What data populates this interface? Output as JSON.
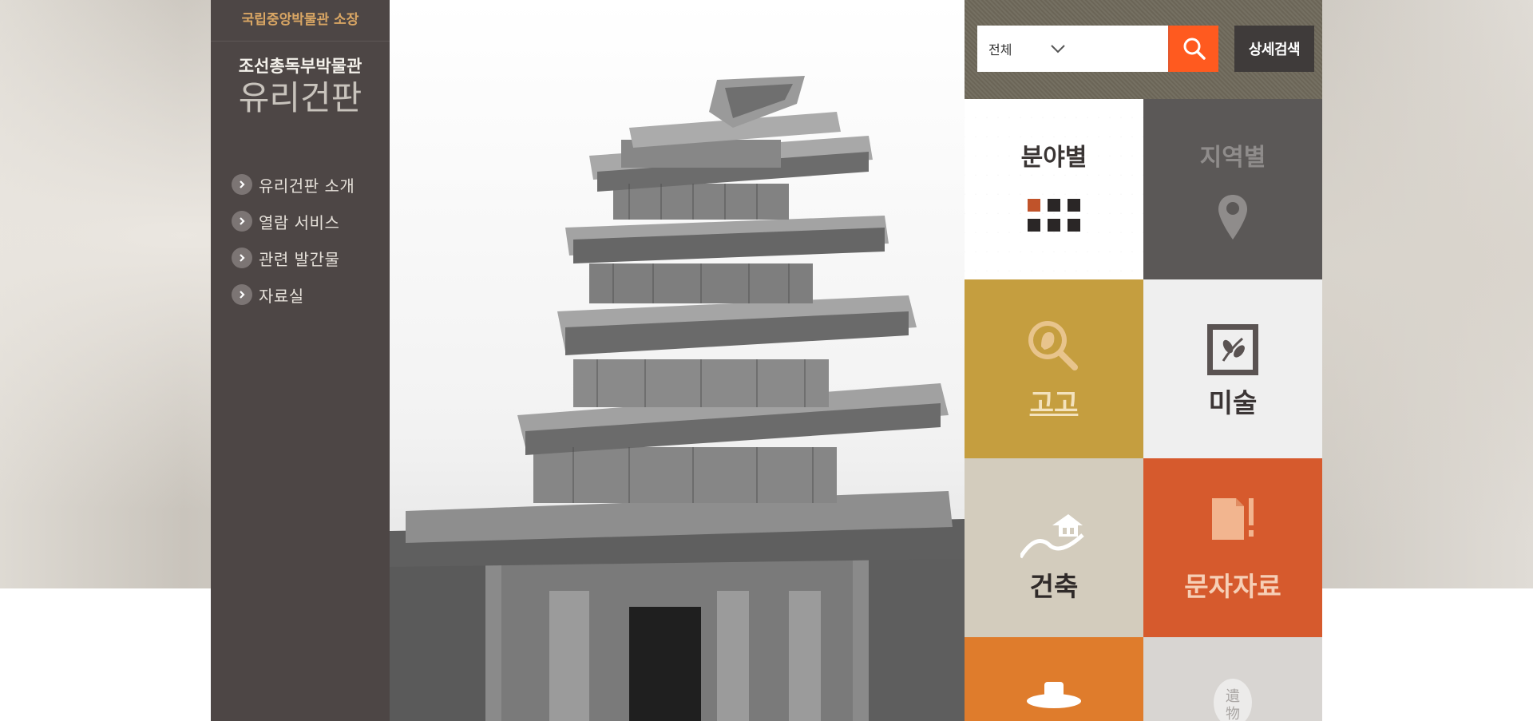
{
  "brand": {
    "subtitle": "국립중앙박물관 소장",
    "title_small": "조선총독부박물관",
    "title_large": "유리건판"
  },
  "menu": [
    {
      "label": "유리건판 소개"
    },
    {
      "label": "열람 서비스"
    },
    {
      "label": "관련 발간물"
    },
    {
      "label": "자료실"
    }
  ],
  "hero": {
    "icon": "stone-pagoda-photo"
  },
  "search": {
    "scope_selected": "전체",
    "keyword_value": "",
    "advanced_label": "상세검색"
  },
  "tabs": {
    "field": "분야별",
    "region": "지역별",
    "active": "field"
  },
  "categories": [
    {
      "label": "고고",
      "icon": "magnifier-figure-icon",
      "color": "#c59e3f"
    },
    {
      "label": "미술",
      "icon": "framed-plant-icon",
      "color": "#efefef"
    },
    {
      "label": "건축",
      "icon": "pavilion-mountain-icon",
      "color": "#d3ccbd"
    },
    {
      "label": "문자자료",
      "icon": "document-brush-icon",
      "color": "#d65a2d"
    },
    {
      "label": "",
      "icon": "gat-hat-icon",
      "color": "#df7c2c"
    },
    {
      "label": "",
      "icon": "relic-seal-icon",
      "color": "#d8d5d2"
    }
  ],
  "colors": {
    "sidebar": "#4d4645",
    "accent_gold": "#d9a664",
    "search_button": "#ff5a1f",
    "advanced_button": "#3f3b3a"
  }
}
